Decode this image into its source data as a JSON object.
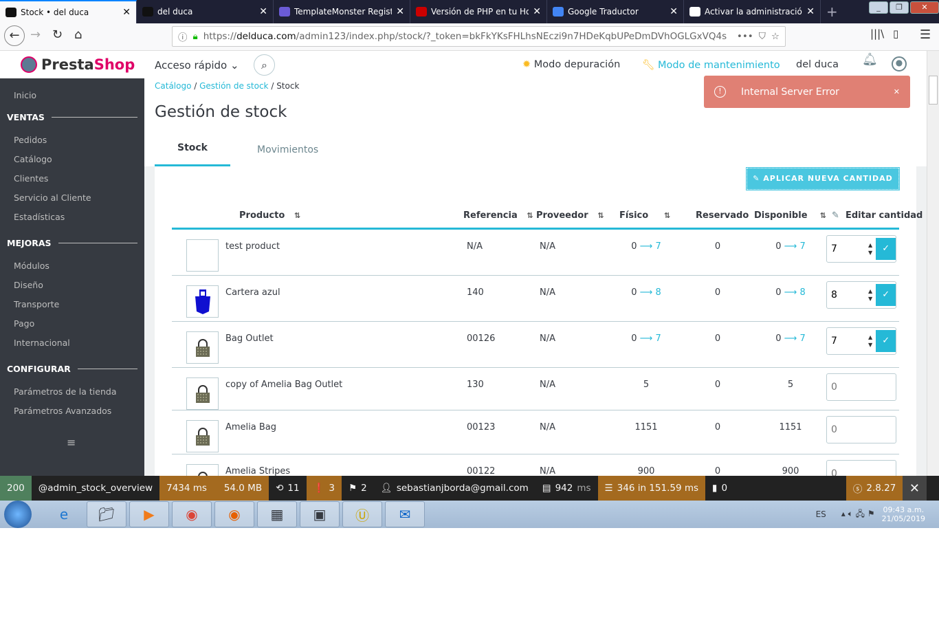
{
  "browser": {
    "tabs": [
      {
        "title": "Stock • del duca",
        "active": true
      },
      {
        "title": "del duca"
      },
      {
        "title": "TemplateMonster Registra"
      },
      {
        "title": "Versión de PHP en tu Host"
      },
      {
        "title": "Google Traductor"
      },
      {
        "title": "Activar la administración a"
      }
    ],
    "url_prefix": "https://",
    "url_domain": "delduca.com",
    "url_path": "/admin123/index.php/stock/?_token=bkFkYKsFHLhsNEczi9n7HDeKqbUPeDmDVhOGLGxVQ4s"
  },
  "header": {
    "logo": "PrestaShop",
    "logo_part1": "Presta",
    "logo_part2": "Shop",
    "quick_access": "Acceso rápido",
    "debug_mode": "Modo depuración",
    "maintenance_mode": "Modo de mantenimiento",
    "shop_name": "del duca",
    "breadcrumb": [
      "Catálogo",
      "Gestión de stock",
      "Stock"
    ],
    "page_title": "Gestión de stock",
    "tabs": [
      "Stock",
      "Movimientos"
    ]
  },
  "alert": {
    "message": "Internal Server Error",
    "color": "#e08074"
  },
  "sidebar": {
    "inicio": "Inicio",
    "sections": [
      {
        "title": "VENTAS",
        "items": [
          "Pedidos",
          "Catálogo",
          "Clientes",
          "Servicio al Cliente",
          "Estadísticas"
        ]
      },
      {
        "title": "MEJORAS",
        "items": [
          "Módulos",
          "Diseño",
          "Transporte",
          "Pago",
          "Internacional"
        ]
      },
      {
        "title": "CONFIGURAR",
        "items": [
          "Parámetros de la tienda",
          "Parámetros Avanzados"
        ]
      }
    ]
  },
  "stock": {
    "apply_button": "APLICAR NUEVA CANTIDAD",
    "columns": {
      "product": "Producto",
      "reference": "Referencia",
      "supplier": "Proveedor",
      "physical": "Físico",
      "reserved": "Reservado",
      "available": "Disponible",
      "edit": "Editar cantidad"
    },
    "rows": [
      {
        "name": "test product",
        "reference": "N/A",
        "supplier": "N/A",
        "physical": "0",
        "physical_new": "7",
        "reserved": "0",
        "available": "0",
        "available_new": "7",
        "edit_value": "7",
        "image": "none"
      },
      {
        "name": "Cartera azul",
        "reference": "140",
        "supplier": "N/A",
        "physical": "0",
        "physical_new": "8",
        "reserved": "0",
        "available": "0",
        "available_new": "8",
        "edit_value": "8",
        "image": "blue-bag"
      },
      {
        "name": "Bag Outlet",
        "reference": "00126",
        "supplier": "N/A",
        "physical": "0",
        "physical_new": "7",
        "reserved": "0",
        "available": "0",
        "available_new": "7",
        "edit_value": "7",
        "image": "bag"
      },
      {
        "name": "copy of Amelia Bag Outlet",
        "reference": "130",
        "supplier": "N/A",
        "physical": "5",
        "reserved": "0",
        "available": "5",
        "edit_placeholder": "0",
        "image": "bag"
      },
      {
        "name": "Amelia Bag",
        "reference": "00123",
        "supplier": "N/A",
        "physical": "1151",
        "reserved": "0",
        "available": "1151",
        "edit_placeholder": "0",
        "image": "bag"
      },
      {
        "name": "Amelia Stripes",
        "reference": "00122",
        "supplier": "N/A",
        "physical": "900",
        "reserved": "0",
        "available": "900",
        "edit_placeholder": "0",
        "image": "bag"
      }
    ]
  },
  "debug": {
    "status": "200",
    "route": "@admin_stock_overview",
    "time": "7434 ms",
    "memory": "54.0 MB",
    "requests": "11",
    "errors": "3",
    "translations": "2",
    "user": "sebastianjborda@gmail.com",
    "render": "942",
    "render_unit": "ms",
    "queries": "346 in 151.59 ms",
    "cache": "0",
    "version": "2.8.27"
  },
  "taskbar": {
    "lang": "ES",
    "time": "09:43 a.m.",
    "date": "21/05/2019"
  }
}
